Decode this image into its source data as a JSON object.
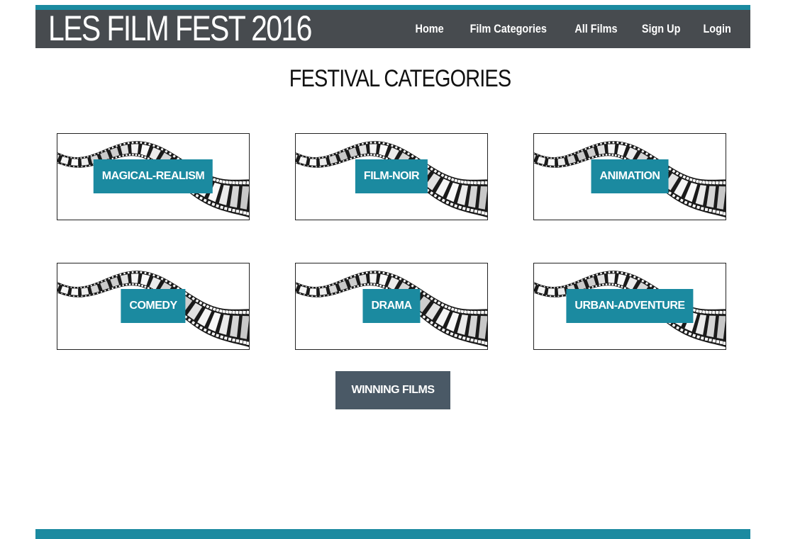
{
  "header": {
    "site_title": "LES FILM FEST 2016",
    "nav": [
      "Home",
      "Film Categories",
      "All Films",
      "Sign Up",
      "Login"
    ]
  },
  "main": {
    "title": "FESTIVAL CATEGORIES",
    "categories": [
      "MAGICAL-REALISM",
      "FILM-NOIR",
      "ANIMATION",
      "COMEDY",
      "DRAMA",
      "URBAN-ADVENTURE"
    ],
    "winning_button": "WINNING FILMS"
  },
  "colors": {
    "accent": "#1b8aa0",
    "header_bg": "#474b4f",
    "button_bg": "#4a5966"
  },
  "icons": {
    "card_image": "film-strip-image"
  }
}
